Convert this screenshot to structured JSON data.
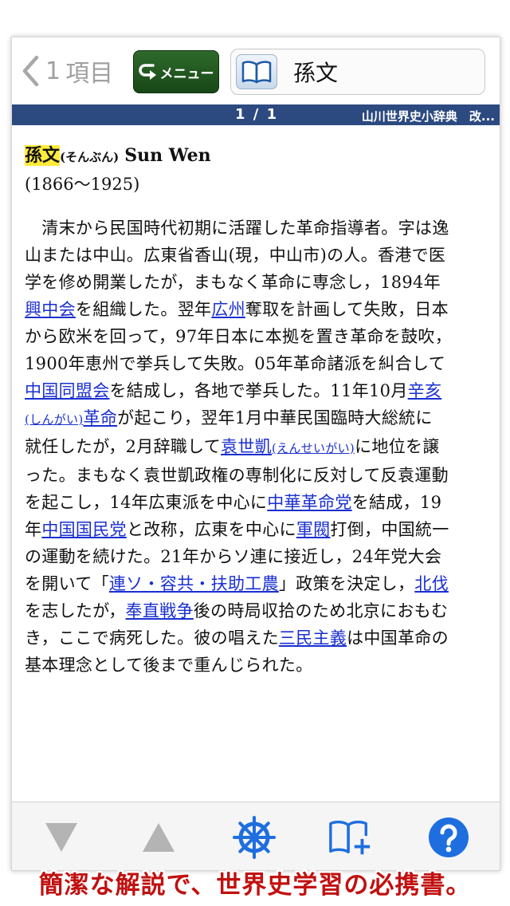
{
  "nav": {
    "back_count": "1",
    "back_label": "項目",
    "menu_label": "メニュー",
    "title": "孫文"
  },
  "pagebar": {
    "count": "1 / 1",
    "source": "山川世界史小辞典　改..."
  },
  "entry": {
    "headword": "孫文",
    "reading": "(そんぶん)",
    "english": "Sun Wen",
    "years": "(1866〜1925)",
    "lines": [
      [
        {
          "t": "　清末から民国時代初期に活躍した革命指導者。字は逸"
        }
      ],
      [
        {
          "t": "山または中山。広東省香山(現，中山市)の人。香港で医"
        }
      ],
      [
        {
          "t": "学を修め開業したが，まもなく革命に専念し，1894年"
        }
      ],
      [
        {
          "t": "興中会",
          "link": true
        },
        {
          "t": "を組織した。翌年"
        },
        {
          "t": "広州",
          "link": true
        },
        {
          "t": "奪取を計画して失敗，日本"
        }
      ],
      [
        {
          "t": "から欧米を回って，97年日本に本拠を置き革命を鼓吹，"
        }
      ],
      [
        {
          "t": "1900年恵州で挙兵して失敗。05年革命諸派を糾合して"
        }
      ],
      [
        {
          "t": "中国同盟会",
          "link": true
        },
        {
          "t": "を結成し，各地で挙兵した。11年10月"
        },
        {
          "t": "辛亥",
          "link": true
        }
      ],
      [
        {
          "t": "(しんがい)",
          "link": true,
          "small": true
        },
        {
          "t": "革命",
          "link": true
        },
        {
          "t": "が起こり，翌年1月中華民国臨時大総統に"
        }
      ],
      [
        {
          "t": "就任したが，2月辞職して"
        },
        {
          "t": "袁世凱",
          "link": true
        },
        {
          "t": "(えんせいがい)",
          "link": true,
          "small": true
        },
        {
          "t": "に地位を譲"
        }
      ],
      [
        {
          "t": "った。まもなく袁世凱政権の専制化に反対して反袁運動"
        }
      ],
      [
        {
          "t": "を起こし，14年広東派を中心に"
        },
        {
          "t": "中華革命党",
          "link": true
        },
        {
          "t": "を結成，19"
        }
      ],
      [
        {
          "t": "年"
        },
        {
          "t": "中国国民党",
          "link": true
        },
        {
          "t": "と改称，広東を中心に"
        },
        {
          "t": "軍閥",
          "link": true
        },
        {
          "t": "打倒，中国統一"
        }
      ],
      [
        {
          "t": "の運動を続けた。21年からソ連に接近し，24年党大会"
        }
      ],
      [
        {
          "t": "を開いて「"
        },
        {
          "t": "連ソ・容共・扶助工農",
          "link": true
        },
        {
          "t": "」政策を決定し，"
        },
        {
          "t": "北伐",
          "link": true
        }
      ],
      [
        {
          "t": "を志したが，"
        },
        {
          "t": "奉直戦争",
          "link": true
        },
        {
          "t": "後の時局収拾のため北京におもむ"
        }
      ],
      [
        {
          "t": "き，ここで病死した。彼の唱えた"
        },
        {
          "t": "三民主義",
          "link": true
        },
        {
          "t": "は中国革命の"
        }
      ],
      [
        {
          "t": "基本理念として後まで重んじられた。"
        }
      ]
    ]
  },
  "toolbar": {
    "icons": [
      "triangle-down-icon",
      "triangle-up-icon",
      "ship-wheel-icon",
      "book-plus-icon",
      "help-icon"
    ],
    "accent": "#1e6ee0",
    "disabled": "#b4b4b4"
  },
  "caption": "簡潔な解説で、世界史学習の必携書。",
  "colors": {
    "pagebar": "#2d4a80",
    "menu_button": "#1e4f1c",
    "link": "#1a2fd0",
    "highlight": "#ffeb3b",
    "caption": "#c21010"
  }
}
